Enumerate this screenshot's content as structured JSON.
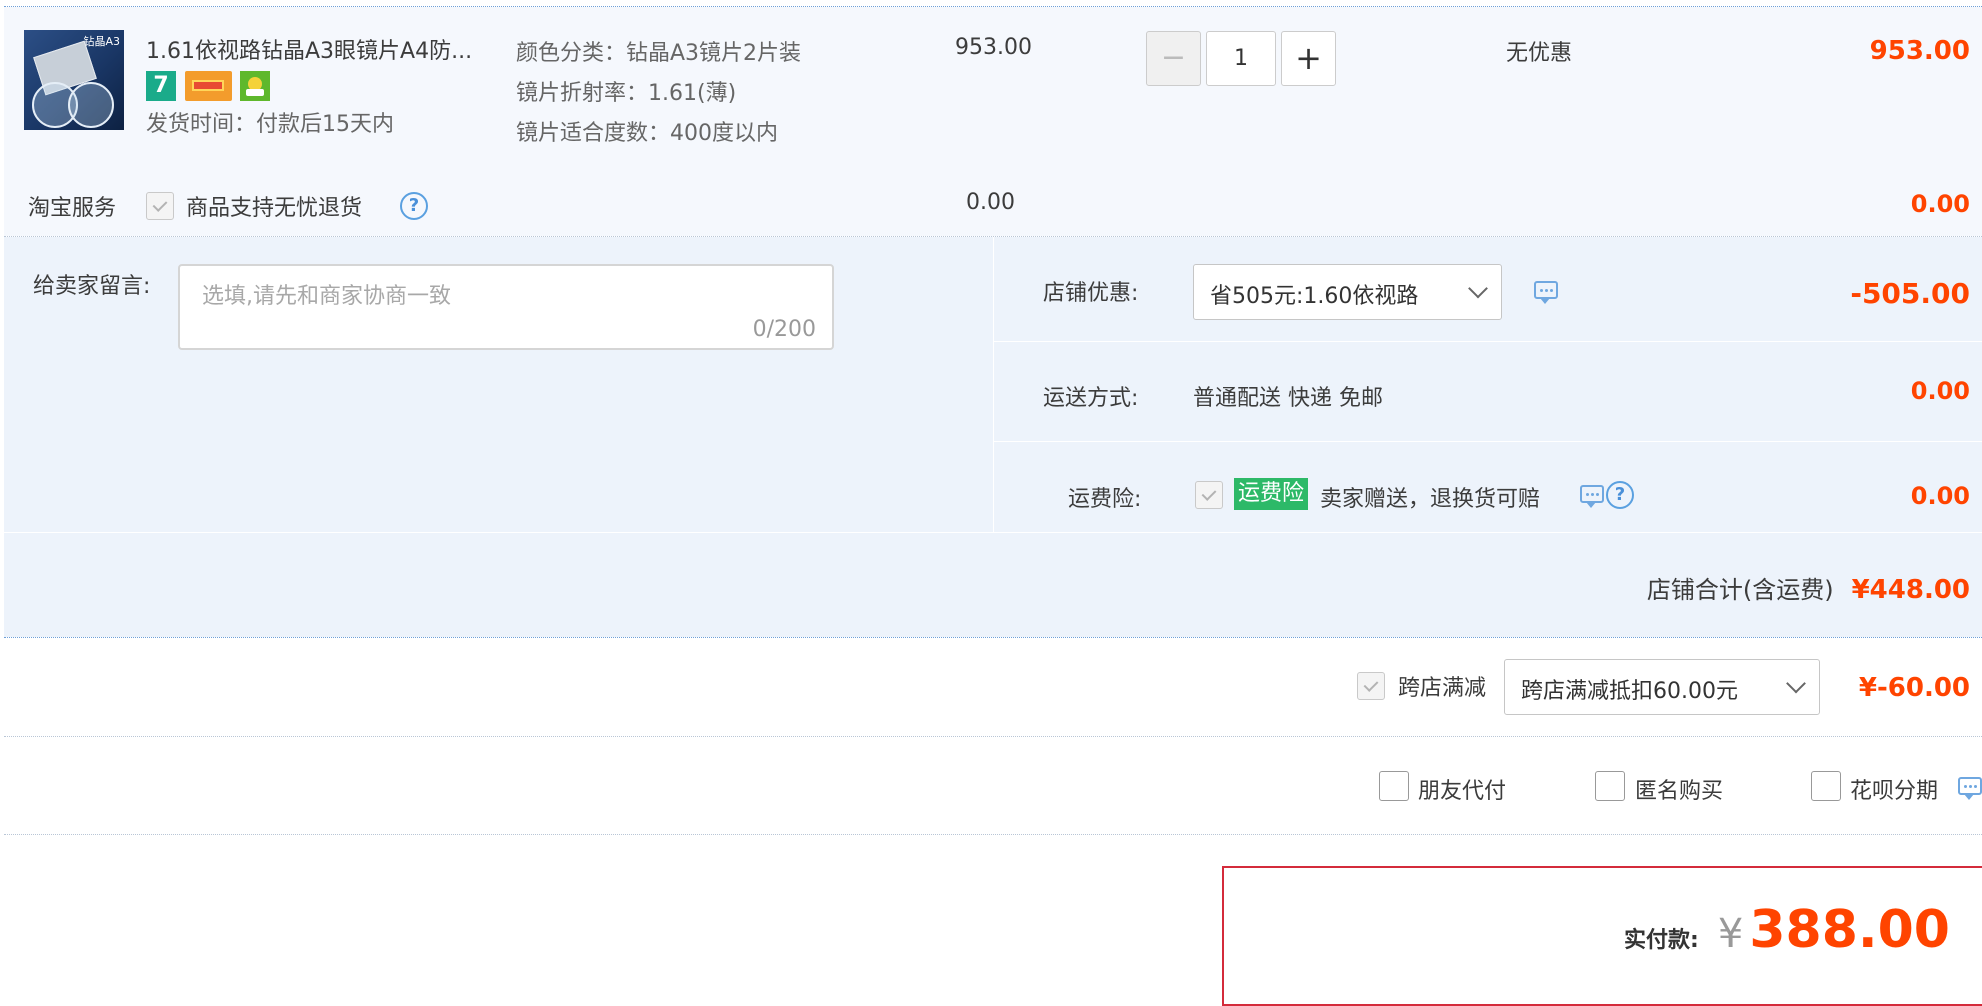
{
  "item": {
    "title": "1.61依视路钻晶A3眼镜片A4防...",
    "thumb_text": "钻晶A3",
    "badge_7": "7",
    "ship_time": "发货时间：付款后15天内",
    "attrs": [
      "颜色分类：钻晶A3镜片2片装",
      "镜片折射率：1.61(薄)",
      "镜片适合度数：400度以内"
    ],
    "price": "953.00",
    "qty_minus": "−",
    "qty": "1",
    "qty_plus": "+",
    "discount": "无优惠",
    "subtotal": "953.00"
  },
  "service": {
    "label": "淘宝服务",
    "option": "商品支持无忧退货",
    "help": "?",
    "price": "0.00",
    "subtotal": "0.00"
  },
  "message": {
    "label": "给卖家留言:",
    "placeholder": "选填,请先和商家协商一致",
    "counter": "0/200"
  },
  "shop_discount": {
    "label": "店铺优惠:",
    "selected": "省505元:1.60依视路",
    "amount": "-505.00"
  },
  "shipping": {
    "label": "运送方式:",
    "value": "普通配送 快递 免邮",
    "amount": "0.00"
  },
  "freight_insurance": {
    "label": "运费险:",
    "tag": "运费险",
    "desc": "卖家赠送，退换货可赔",
    "help": "?",
    "amount": "0.00"
  },
  "shop_total": {
    "label": "店铺合计(含运费)",
    "amount": "¥448.00"
  },
  "cross_store": {
    "label": "跨店满减",
    "selected": "跨店满减抵扣60.00元",
    "amount": "¥-60.00"
  },
  "options": [
    "朋友代付",
    "匿名购买",
    "花呗分期"
  ],
  "pay": {
    "label": "实付款:",
    "currency": "¥",
    "amount": "388.00"
  },
  "colors": {
    "accent": "#ff4400",
    "row_bg": "#f5f8fd",
    "panel_bg": "#edf3fb",
    "tag_green": "#2db968",
    "pay_border": "#d42b3b"
  }
}
